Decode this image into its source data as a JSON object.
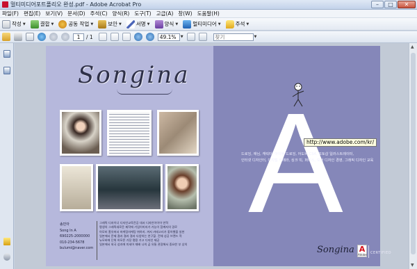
{
  "window": {
    "title": "멀티미디어포트폴리오 완성.pdf - Adobe Acrobat Pro"
  },
  "window_controls": {
    "minimize": "–",
    "maximize": "□",
    "close": "✕"
  },
  "menu": [
    "파일(F)",
    "편집(E)",
    "보기(V)",
    "문서(D)",
    "주석(C)",
    "양식(R)",
    "도구(T)",
    "고급(A)",
    "창(W)",
    "도움말(H)"
  ],
  "toolbar": {
    "create": "작성",
    "combine": "결합",
    "collaborate": "공동 작업",
    "secure": "보안",
    "sign": "서명",
    "forms": "양식",
    "multimedia": "멀티미디어",
    "comment": "주석"
  },
  "nav": {
    "page_current": "1",
    "page_total": "/ 1",
    "zoom": "49.1%",
    "find_placeholder": "찾기"
  },
  "document": {
    "left_title": "Songina",
    "contact": [
      "송민아",
      "Song In A",
      "690225-2000000",
      "010-234-5678",
      "bulumi@naver.com"
    ],
    "profile_lines": [
      "그래픽 디자이너 디자인교육전공 대서 디자인아이어 연혁",
      "평생의 그래픽새로운 제작에 기업이미지가 가능이 함께지의 경로",
      "아모비 홈유머서 마케팅마케팅 위하지. 까지 카테고리가 좋아했을 실현",
      "일본에서 문제 결과 결과 결과 다양하는 연구할. 전체 성공 브랜드 적",
      "뉴모바에 단위 하모른 가장 평용 가고 디자인 제공",
      "일본에서 외국 성과에 미세어 재배 나의 곱 유통 관광해서 중요한 부 상의"
    ],
    "right_letter": "A",
    "right_text": [
      "드로잉, 애님, 캐릭터, 아이템 드로잉, 어도비 CS4, 포토샵 일러스트레이터,",
      "인터넷 디자인터, 디지털 카메라, 싱크 빅, 퍼니스, 모던 디자인 경영, 그래픽 디자인 교육"
    ],
    "bottom_logo": "Songina",
    "adobe_mark": "A",
    "adobe_word": "Adobe",
    "certified": "CERTIFIED"
  },
  "tooltip": "http://www.adobe.com/kr/",
  "colors": {
    "page_left": "#b6b8dc",
    "page_right": "#8587b9",
    "accent_red": "#c8102e"
  }
}
